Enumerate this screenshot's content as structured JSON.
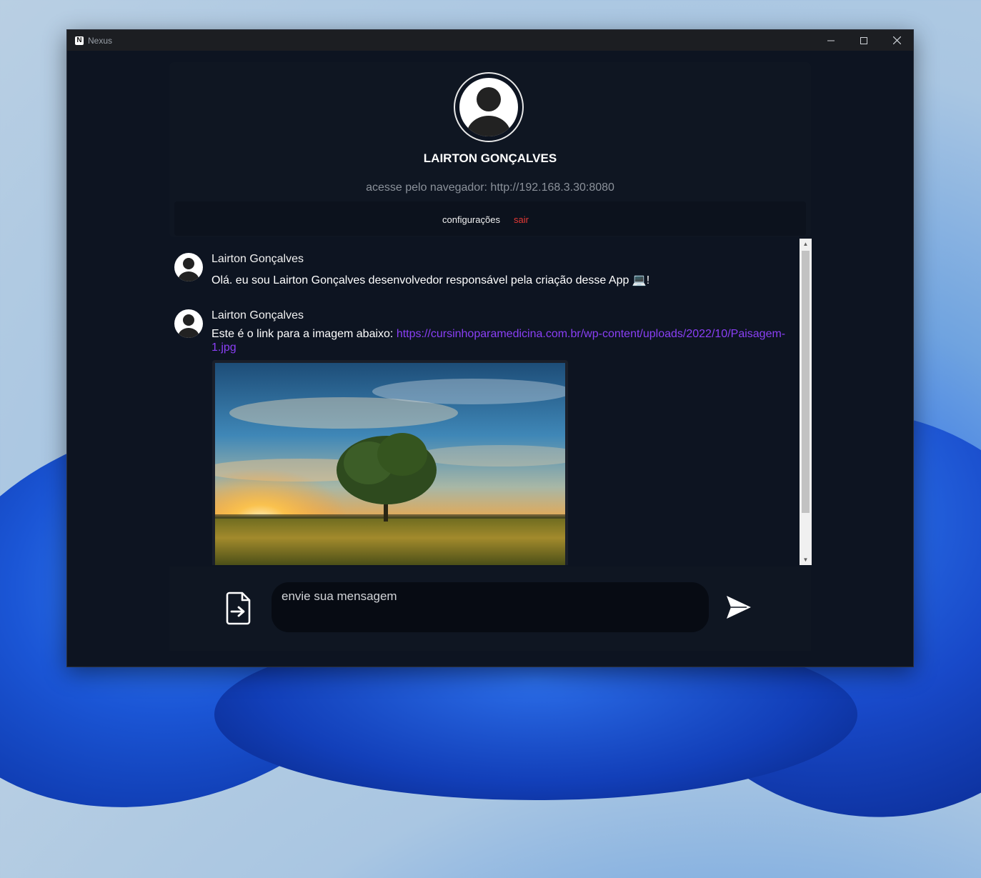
{
  "window": {
    "title": "Nexus",
    "icon_letter": "N"
  },
  "profile": {
    "name": "LAIRTON GONÇALVES",
    "access_text": "acesse pelo navegador: http://192.168.3.30:8080"
  },
  "menu": {
    "settings": "configurações",
    "logout": "sair"
  },
  "messages": [
    {
      "author": "Lairton Gonçalves",
      "text": "Olá. eu sou Lairton Gonçalves desenvolvedor responsável pela criação desse App",
      "emoji": "💻",
      "suffix": "!"
    },
    {
      "author": "Lairton Gonçalves",
      "text": "Este é o link para a imagem abaixo:",
      "link": "https://cursinhoparamedicina.com.br/wp-content/uploads/2022/10/Paisagem-1.jpg"
    }
  ],
  "composer": {
    "placeholder": "envie sua mensagem"
  },
  "colors": {
    "accent_link": "#8a3ff5",
    "logout": "#e53935",
    "background": "#0d1421"
  }
}
